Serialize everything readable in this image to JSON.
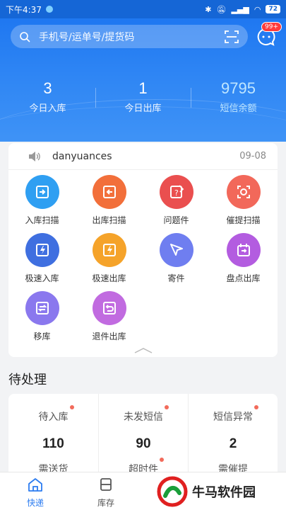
{
  "statusbar": {
    "time": "下午4:37",
    "battery": "72"
  },
  "search": {
    "placeholder": "手机号/运单号/提货码"
  },
  "messages": {
    "badge": "99+"
  },
  "stats": [
    {
      "value": "3",
      "label": "今日入库"
    },
    {
      "value": "1",
      "label": "今日出库"
    },
    {
      "value": "9795",
      "label": "短信余额"
    }
  ],
  "notice": {
    "user": "danyuances",
    "date": "09-08"
  },
  "grid": [
    {
      "label": "入库扫描",
      "color": "#2f9ff2",
      "icon": "scan-in-icon"
    },
    {
      "label": "出库扫描",
      "color": "#f26f3a",
      "icon": "scan-out-icon"
    },
    {
      "label": "问题件",
      "color": "#ea4f4f",
      "icon": "problem-icon"
    },
    {
      "label": "催提扫描",
      "color": "#f2685a",
      "icon": "urge-scan-icon"
    },
    {
      "label": "极速入库",
      "color": "#3f6fe0",
      "icon": "fast-in-icon"
    },
    {
      "label": "极速出库",
      "color": "#f5a32a",
      "icon": "fast-out-icon"
    },
    {
      "label": "寄件",
      "color": "#6f7ef0",
      "icon": "send-icon"
    },
    {
      "label": "盘点出库",
      "color": "#b35ce0",
      "icon": "inventory-out-icon"
    },
    {
      "label": "移库",
      "color": "#8a78ee",
      "icon": "move-icon"
    },
    {
      "label": "退件出库",
      "color": "#c16be0",
      "icon": "return-icon"
    }
  ],
  "pending": {
    "title": "待处理",
    "items": [
      {
        "label": "待入库",
        "value": "110"
      },
      {
        "label": "未发短信",
        "value": "90"
      },
      {
        "label": "短信异常",
        "value": "2"
      }
    ],
    "row2": [
      "需送货",
      "超时件",
      "需催提"
    ]
  },
  "tabs": [
    {
      "label": "快递",
      "active": true
    },
    {
      "label": "库存",
      "active": false
    }
  ],
  "watermark": {
    "text": "牛马软件园"
  }
}
